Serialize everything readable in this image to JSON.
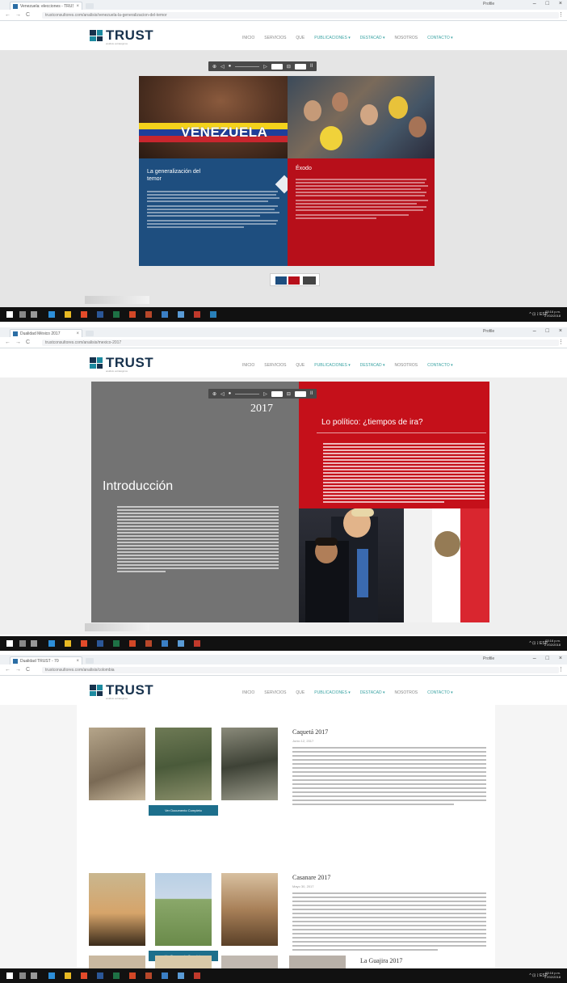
{
  "screens": [
    {
      "tab_title": "Venezuela: elecciones - TRUST",
      "url": "trustconsultores.com/analisis/venezuela-la-generalizacion-del-temor",
      "page_left_title": "La generalización del temor",
      "page_right_title": "Éxodo",
      "photo_text": "VENEZUELA"
    },
    {
      "tab_title": "Dualidad México 2017",
      "url": "trustconsultores.com/analisis/mexico-2017",
      "year": "2017",
      "left_heading": "Introducción",
      "right_heading": "Lo político: ¿tiempos de ira?"
    },
    {
      "tab_title": "Dualidad TRUST - 70",
      "url": "trustconsultores.com/analisis/colombia",
      "articles": [
        {
          "title": "Caquetá 2017",
          "date": "Junio 12, 2017",
          "button": "Ver Documento Completo"
        },
        {
          "title": "Casanare 2017",
          "date": "Mayo 30, 2017",
          "button": "Ver Documento Completo"
        },
        {
          "title": "La Guajira 2017"
        }
      ]
    }
  ],
  "browser": {
    "user": "Profile",
    "back": "←",
    "forward": "→",
    "reload": "C",
    "menu": "⋮",
    "minimize": "–",
    "maximize": "□",
    "close": "×",
    "tab_close": "×"
  },
  "site": {
    "logo": "TRUST",
    "logo_tagline": "análisis estratégicos",
    "nav": [
      "INICIO",
      "SERVICIOS",
      "QUE",
      "PUBLICACIONES ▾",
      "DESTACAD ▾",
      "NOSOTROS",
      "CONTACTO ▾"
    ]
  },
  "viewer": {
    "tools": [
      "⊕",
      "◁",
      "●",
      "▷",
      "⊟",
      "II"
    ]
  },
  "taskbar": {
    "tray": "^ ⊡ ⟟ ESP",
    "time": "03:16 p.m.",
    "date": "27/02/2018"
  },
  "colors": {
    "navy": "#17324d",
    "teal": "#1c8aa0",
    "blue_page": "#1e4e7f",
    "red_page": "#b70f1a",
    "grey_page": "#737373",
    "button": "#1d6f8c"
  }
}
